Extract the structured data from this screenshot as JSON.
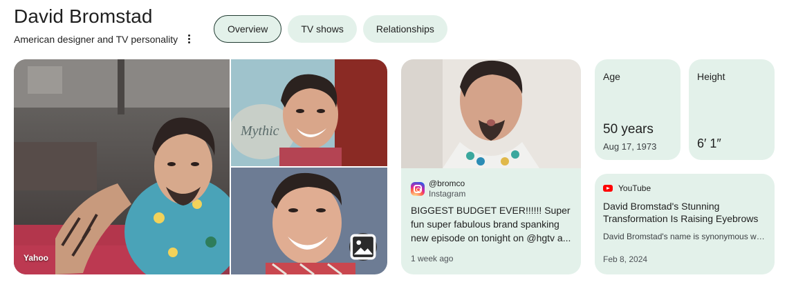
{
  "entity": {
    "name": "David Bromstad",
    "description": "American designer and TV personality"
  },
  "tabs": [
    {
      "label": "Overview",
      "active": true
    },
    {
      "label": "TV shows",
      "active": false
    },
    {
      "label": "Relationships",
      "active": false
    }
  ],
  "gallery": {
    "main_source": "Yahoo",
    "more_images_icon": "image-icon"
  },
  "instagram_card": {
    "icon": "instagram-icon",
    "handle": "@bromco",
    "source": "Instagram",
    "text": "BIGGEST BUDGET EVER!!!!!! Super fun super fabulous brand spanking new episode on tonight on @hgtv a...",
    "time": "1 week ago"
  },
  "stats": {
    "age": {
      "label": "Age",
      "value": "50 years",
      "sub": "Aug 17, 1973"
    },
    "height": {
      "label": "Height",
      "value": "6′ 1″"
    }
  },
  "youtube_card": {
    "icon": "youtube-icon",
    "source": "YouTube",
    "title": "David Bromstad's Stunning Transformation Is Raising Eyebrows",
    "description": "David Bromstad's name is synonymous with colorful design",
    "date": "Feb 8, 2024"
  },
  "colors": {
    "card_bg": "#e3f1ea",
    "text": "#1f1f1f",
    "active_chip_border": "#1f3a30"
  }
}
